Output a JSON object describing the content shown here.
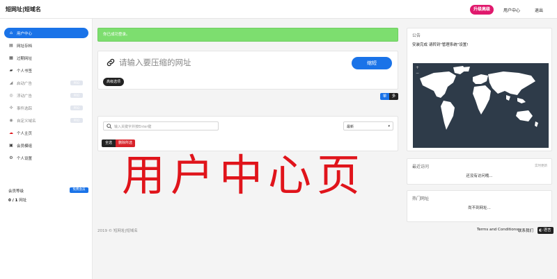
{
  "header": {
    "brand": "短网址|短域名",
    "upgrade_label": "升级高级",
    "user_center_label": "用户中心",
    "logout_label": "退出"
  },
  "sidebar": {
    "items": [
      {
        "label": "用户中心",
        "icon": "home-icon",
        "pro": ""
      },
      {
        "label": "网址存档",
        "icon": "archive-icon",
        "pro": ""
      },
      {
        "label": "过期网址",
        "icon": "calendar-icon",
        "pro": ""
      },
      {
        "label": "个人书签",
        "icon": "folder-icon",
        "pro": ""
      },
      {
        "label": "启动广告",
        "icon": "megaphone-icon",
        "pro": "PRO"
      },
      {
        "label": "浮动广告",
        "icon": "circle-icon",
        "pro": "PRO"
      },
      {
        "label": "事件选踪",
        "icon": "network-icon",
        "pro": "PRO"
      },
      {
        "label": "自定义域名",
        "icon": "globe-icon",
        "pro": "PRO"
      },
      {
        "label": "个人主页",
        "icon": "cloud-icon",
        "pro": ""
      },
      {
        "label": "会员模组",
        "icon": "module-icon",
        "pro": ""
      },
      {
        "label": "个人设置",
        "icon": "gear-icon",
        "pro": ""
      }
    ],
    "membership_label": "会员等级",
    "membership_badge": "免费会员",
    "usage_count": "0 / 1",
    "usage_suffix": "网址"
  },
  "alert": {
    "text": "你已成功登录。"
  },
  "shorten": {
    "placeholder": "请输入要压缩的网址",
    "button_label": "缩短",
    "advanced_label": "高级选项",
    "single_label": "单",
    "multi_label": "多"
  },
  "list": {
    "search_placeholder": "输入关键字并按Enter键",
    "sort_value": "最新",
    "all_label": "全选",
    "delete_label": "删除所选"
  },
  "announcement": {
    "title": "公告",
    "text": "安装完成 请转到\"管理系统\"设置!"
  },
  "recent_visits": {
    "title": "最近访问",
    "note": "实时更新",
    "message": "还没有访问哦..."
  },
  "popular_urls": {
    "title": "热门网址",
    "message": "尚不到网址..."
  },
  "map": {
    "zoom_in": "+",
    "zoom_out": "−"
  },
  "footer": {
    "copyright": "2019 © 短网址|短域名",
    "terms": "Terms and Conditions",
    "contact": "联系我们",
    "language": "语言"
  },
  "overlay_text": "用户中心页",
  "colors": {
    "primary": "#1a73e8",
    "accent": "#e0196d",
    "success": "#7dde6f",
    "danger": "#d8232a",
    "map_bg": "#2e3b49"
  }
}
